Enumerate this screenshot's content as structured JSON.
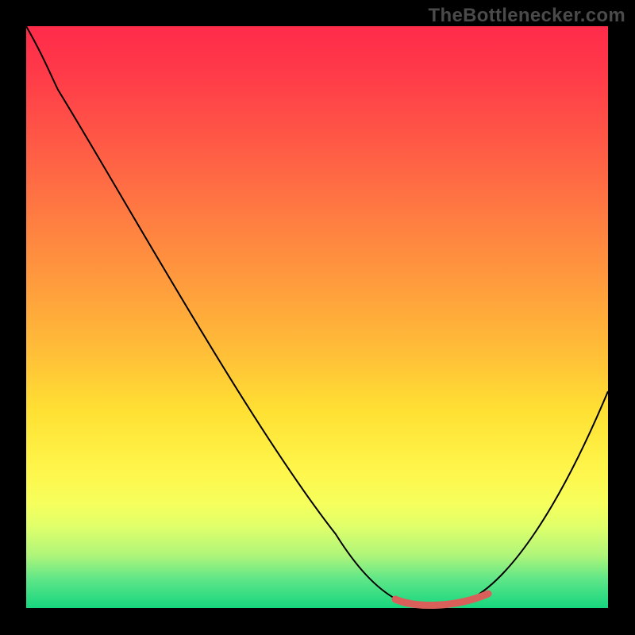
{
  "brand": {
    "text": "TheBottlenecker.com"
  },
  "colors": {
    "background": "#000000",
    "curve": "#000000",
    "highlight": "#d9605a",
    "gradient_stops": [
      "#ff2b4a",
      "#ff3a49",
      "#ff5946",
      "#ff7a42",
      "#ff9b3d",
      "#ffbe38",
      "#ffe033",
      "#fff54a",
      "#f6ff5c",
      "#e0ff6a",
      "#aef57a",
      "#5fe688",
      "#16d67e"
    ]
  },
  "chart_data": {
    "type": "line",
    "title": "",
    "xlabel": "",
    "ylabel": "",
    "xlim": [
      0,
      100
    ],
    "ylim": [
      0,
      100
    ],
    "x": [
      0,
      4,
      10,
      20,
      30,
      40,
      50,
      56,
      60,
      64,
      68,
      72,
      76,
      80,
      85,
      90,
      95,
      100
    ],
    "values": [
      100,
      95,
      89,
      74,
      59,
      45,
      30,
      20,
      12,
      6,
      2,
      0,
      0,
      2,
      9,
      18,
      28,
      37
    ],
    "highlight_range_x": [
      64,
      80
    ],
    "notes": "y-axis reads as bottleneck percentage (0 at bottom, 100 at top). Valley floor of curve between x≈64 and x≈80 is emphasized with a thick red-ish stroke."
  }
}
